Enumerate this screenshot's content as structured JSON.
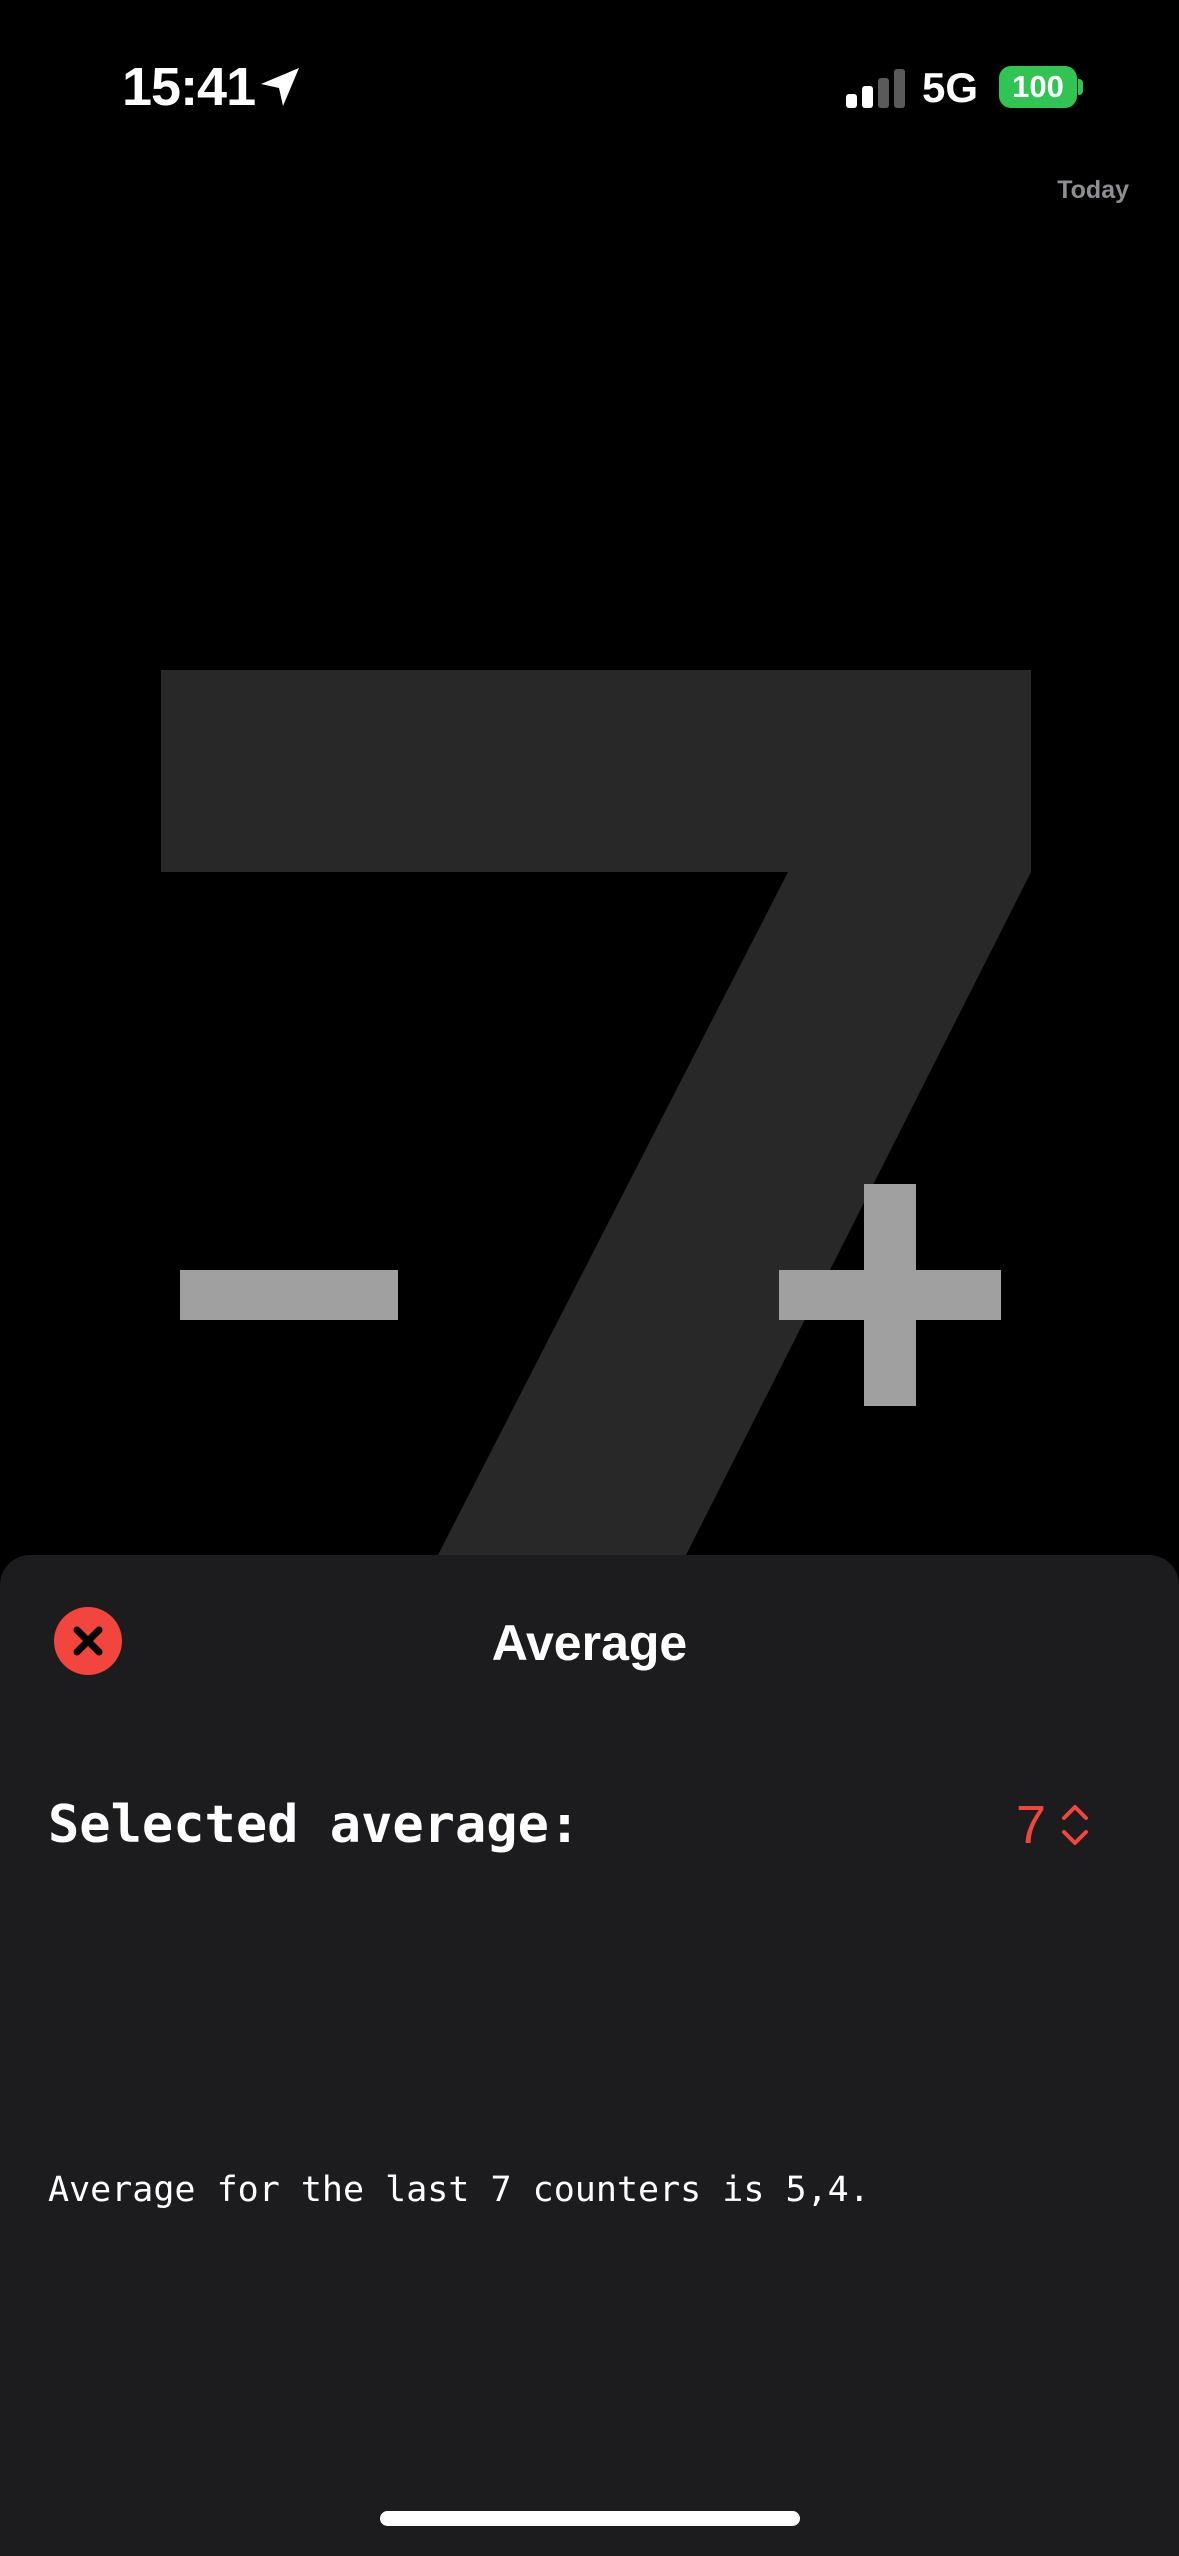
{
  "status_bar": {
    "time": "15:41",
    "network": "5G",
    "battery_level": "100",
    "signal_bars_active": 2,
    "signal_bars_total": 4,
    "icons": [
      "location-arrow-icon",
      "signal-icon",
      "battery-icon"
    ]
  },
  "counter": {
    "period_label": "Today",
    "value": "7",
    "decrement_icon": "minus-icon",
    "increment_icon": "plus-icon"
  },
  "sheet": {
    "title": "Average",
    "close_icon": "close-icon",
    "selected_label": "Selected average:",
    "selected_value": "7",
    "picker_icon": "chevron-up-down-icon",
    "summary": "Average for the last 7 counters is 5,4."
  },
  "colors": {
    "background": "#000000",
    "sheet_background": "#1c1c1e",
    "accent_red": "#f2453d",
    "counter_digit": "#282828",
    "button_gray": "#a0a0a0",
    "battery_green": "#30c552",
    "secondary_text": "#8e8e93"
  }
}
